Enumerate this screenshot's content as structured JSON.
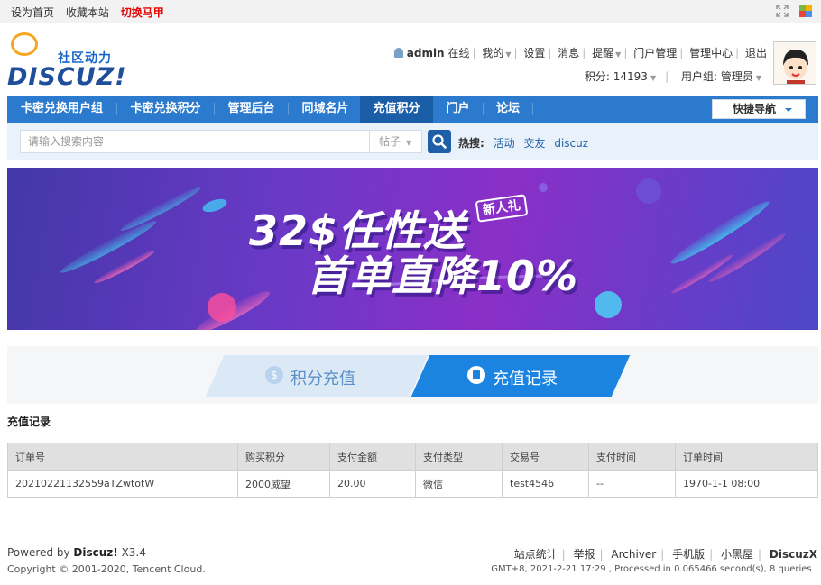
{
  "topbar": {
    "links": [
      "设为首页",
      "收藏本站"
    ],
    "switch_label": "切换马甲"
  },
  "logo": {
    "tagline": "社区动力",
    "name": "DISCUZ!"
  },
  "user_menu": {
    "username": "admin",
    "status": "在线",
    "items": [
      "我的",
      "设置",
      "消息",
      "提醒",
      "门户管理",
      "管理中心",
      "退出"
    ],
    "points_label": "积分: 14193",
    "group_label": "用户组: 管理员"
  },
  "nav": {
    "items": [
      "卡密兑换用户组",
      "卡密兑换积分",
      "管理后台",
      "同城名片",
      "充值积分",
      "门户",
      "论坛"
    ],
    "active_index": 4,
    "quick_nav": "快捷导航"
  },
  "search": {
    "placeholder": "请输入搜索内容",
    "type": "帖子",
    "hot_label": "热搜:",
    "hot_items": [
      "活动",
      "交友",
      "discuz"
    ]
  },
  "banner": {
    "line1": "32$任性送",
    "line2": "首单直降10%",
    "tag": "新人礼"
  },
  "tabs": {
    "tab1": "积分充值",
    "tab2": "充值记录",
    "active": "充值记录"
  },
  "record": {
    "title": "充值记录",
    "columns": [
      "订单号",
      "购买积分",
      "支付金额",
      "支付类型",
      "交易号",
      "支付时间",
      "订单时间"
    ],
    "rows": [
      [
        "20210221132559aTZwtotW",
        "2000威望",
        "20.00",
        "微信",
        "test4546",
        "--",
        "1970-1-1 08:00"
      ]
    ]
  },
  "footer": {
    "powered_prefix": "Powered by",
    "powered_name": "Discuz!",
    "version": "X3.4",
    "copyright": "Copyright © 2001-2020, Tencent Cloud.",
    "links": [
      "站点统计",
      "举报",
      "Archiver",
      "手机版",
      "小黑屋"
    ],
    "brand": "DiscuzX",
    "stats": "GMT+8, 2021-2-21 17:29 , Processed in 0.065466 second(s), 8 queries ."
  },
  "colors": {
    "nav_bg": "#2b7acd",
    "nav_active": "#1b5ea8",
    "tab_active": "#1b84e0",
    "topbar_red": "#e60000"
  }
}
